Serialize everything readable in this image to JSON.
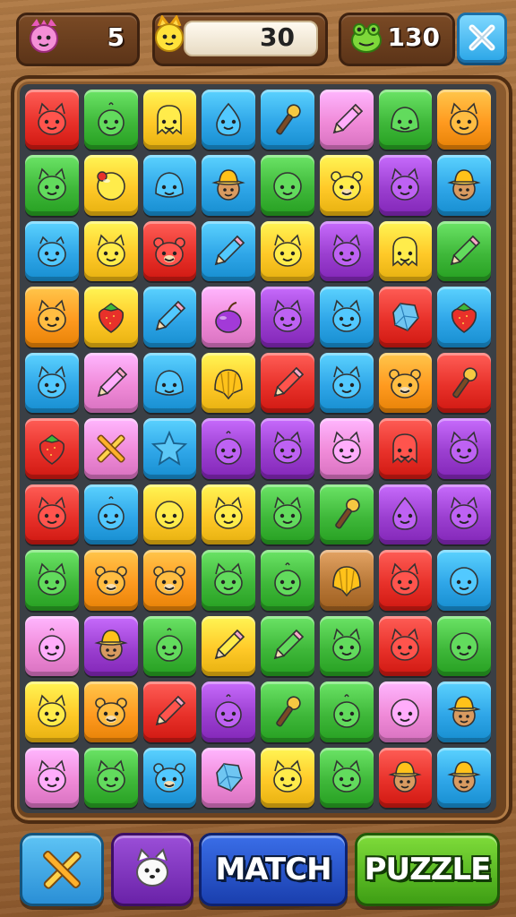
{
  "hud": {
    "lives": "5",
    "moves": "30",
    "coins": "130"
  },
  "buttons": {
    "match": "MATCH",
    "puzzle": "PUZZLE"
  },
  "colors": {
    "red": "#e8312a",
    "green": "#3fb83a",
    "yellow": "#ffc928",
    "blue": "#2fa6e8",
    "pink": "#f08ad8",
    "purple": "#9b3fd0",
    "orange": "#ff9a1f",
    "brown": "#b87838"
  },
  "board": [
    [
      [
        "red",
        "cat-face-icon"
      ],
      [
        "green",
        "chick-icon"
      ],
      [
        "yellow",
        "ghost-icon"
      ],
      [
        "blue",
        "drop-face-icon"
      ],
      [
        "blue",
        "microphone-icon"
      ],
      [
        "pink",
        "pencil-icon"
      ],
      [
        "green",
        "blob-icon"
      ],
      [
        "orange",
        "cat-face-icon"
      ]
    ],
    [
      [
        "green",
        "cat-face-icon"
      ],
      [
        "yellow",
        "ball-icon"
      ],
      [
        "blue",
        "blob-icon"
      ],
      [
        "blue",
        "explorer-icon"
      ],
      [
        "green",
        "smiley-icon"
      ],
      [
        "yellow",
        "bear-icon"
      ],
      [
        "purple",
        "cat-face-icon"
      ],
      [
        "blue",
        "explorer-icon"
      ]
    ],
    [
      [
        "blue",
        "pig-icon"
      ],
      [
        "yellow",
        "cat-face-icon"
      ],
      [
        "red",
        "bear-icon"
      ],
      [
        "blue",
        "pencil-icon"
      ],
      [
        "yellow",
        "cat-face-icon"
      ],
      [
        "purple",
        "cat-face-icon"
      ],
      [
        "yellow",
        "ghost-icon"
      ],
      [
        "green",
        "pencil-icon"
      ]
    ],
    [
      [
        "orange",
        "cat-face-icon"
      ],
      [
        "yellow",
        "strawberry-icon"
      ],
      [
        "blue",
        "pencil-icon"
      ],
      [
        "pink",
        "plum-icon"
      ],
      [
        "purple",
        "cat-face-icon"
      ],
      [
        "blue",
        "cat-face-icon"
      ],
      [
        "red",
        "gem-icon"
      ],
      [
        "blue",
        "strawberry-icon"
      ]
    ],
    [
      [
        "blue",
        "cat-face-icon"
      ],
      [
        "pink",
        "pencil-icon"
      ],
      [
        "blue",
        "blob-icon"
      ],
      [
        "yellow",
        "shell-icon"
      ],
      [
        "red",
        "pencil-icon"
      ],
      [
        "blue",
        "cat-face-icon"
      ],
      [
        "orange",
        "bear-icon"
      ],
      [
        "red",
        "microphone-icon"
      ]
    ],
    [
      [
        "red",
        "strawberry-icon"
      ],
      [
        "pink",
        "crossed-tools-icon"
      ],
      [
        "blue",
        "star-icon"
      ],
      [
        "purple",
        "chick-icon"
      ],
      [
        "purple",
        "cat-face-icon"
      ],
      [
        "pink",
        "cat-face-icon"
      ],
      [
        "red",
        "ghost-icon"
      ],
      [
        "purple",
        "cat-face-icon"
      ]
    ],
    [
      [
        "red",
        "cat-face-icon"
      ],
      [
        "blue",
        "chick-icon"
      ],
      [
        "yellow",
        "smiley-icon"
      ],
      [
        "yellow",
        "cat-face-icon"
      ],
      [
        "green",
        "cat-face-icon"
      ],
      [
        "green",
        "microphone-icon"
      ],
      [
        "purple",
        "drop-face-icon"
      ],
      [
        "purple",
        "cat-face-icon"
      ]
    ],
    [
      [
        "green",
        "cat-face-icon"
      ],
      [
        "orange",
        "bear-icon"
      ],
      [
        "orange",
        "bear-icon"
      ],
      [
        "green",
        "cat-face-icon"
      ],
      [
        "green",
        "chick-icon"
      ],
      [
        "brown",
        "shell-icon"
      ],
      [
        "red",
        "cat-face-icon"
      ],
      [
        "blue",
        "smiley-icon"
      ]
    ],
    [
      [
        "pink",
        "chick-icon"
      ],
      [
        "purple",
        "explorer-icon"
      ],
      [
        "green",
        "chick-icon"
      ],
      [
        "yellow",
        "pencil-icon"
      ],
      [
        "green",
        "pencil-icon"
      ],
      [
        "green",
        "cat-face-icon"
      ],
      [
        "red",
        "cat-face-icon"
      ],
      [
        "green",
        "smiley-icon"
      ]
    ],
    [
      [
        "yellow",
        "cat-face-icon"
      ],
      [
        "orange",
        "bear-icon"
      ],
      [
        "red",
        "pencil-icon"
      ],
      [
        "purple",
        "chick-icon"
      ],
      [
        "green",
        "microphone-icon"
      ],
      [
        "green",
        "chick-icon"
      ],
      [
        "pink",
        "smiley-icon"
      ],
      [
        "blue",
        "explorer-icon"
      ]
    ],
    [
      [
        "pink",
        "cat-face-icon"
      ],
      [
        "green",
        "cat-face-icon"
      ],
      [
        "blue",
        "bear-icon"
      ],
      [
        "pink",
        "gem-icon"
      ],
      [
        "yellow",
        "cat-face-icon"
      ],
      [
        "green",
        "cat-face-icon"
      ],
      [
        "red",
        "explorer-icon"
      ],
      [
        "blue",
        "explorer-icon"
      ]
    ]
  ]
}
